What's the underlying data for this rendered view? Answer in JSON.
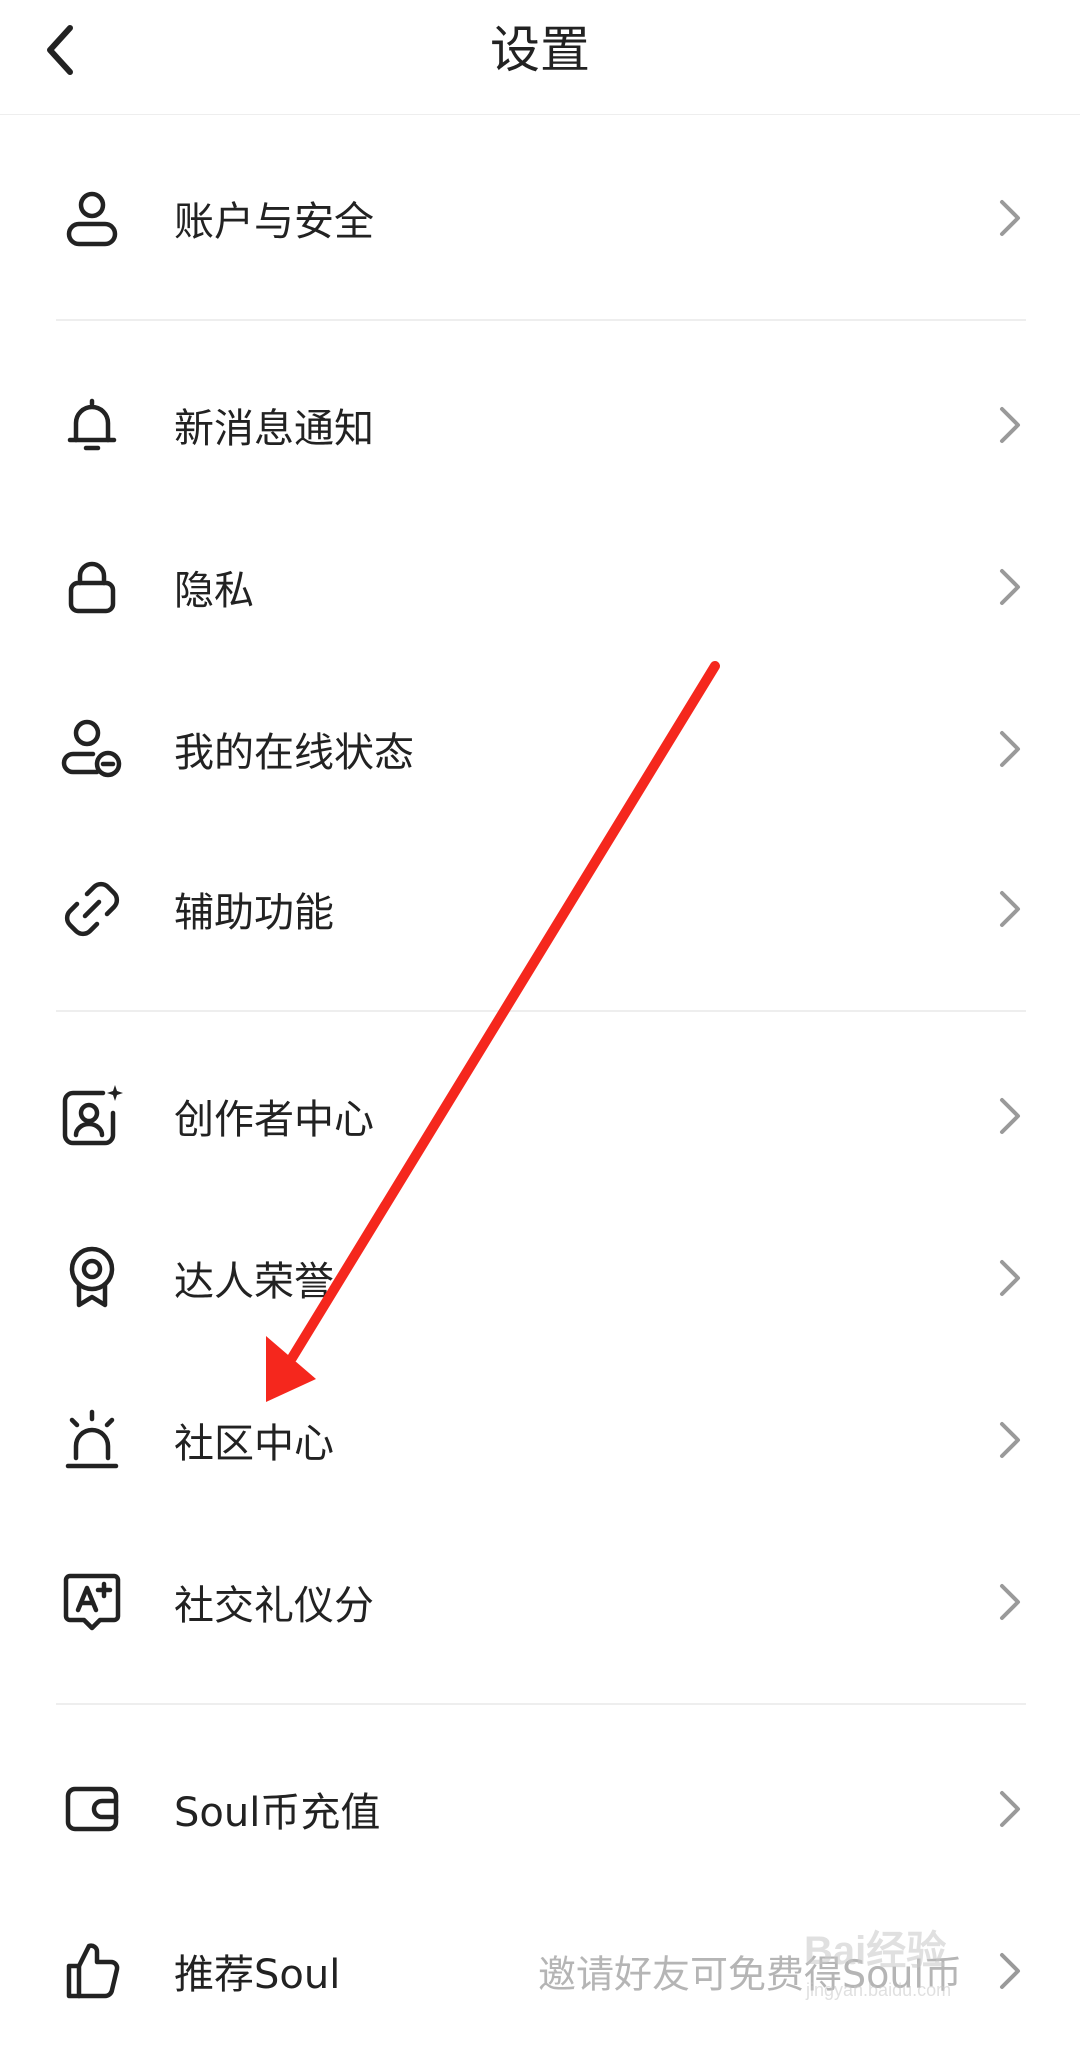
{
  "header": {
    "title": "设置",
    "back_icon": "chevron-left-icon"
  },
  "menu": [
    {
      "id": "account-security",
      "label": "账户与安全",
      "icon": "user-icon"
    },
    {
      "id": "notifications",
      "label": "新消息通知",
      "icon": "bell-icon"
    },
    {
      "id": "privacy",
      "label": "隐私",
      "icon": "lock-icon"
    },
    {
      "id": "online-status",
      "label": "我的在线状态",
      "icon": "user-status-icon"
    },
    {
      "id": "accessibility",
      "label": "辅助功能",
      "icon": "link-icon"
    },
    {
      "id": "creator-center",
      "label": "创作者中心",
      "icon": "creator-portrait-icon"
    },
    {
      "id": "expert-honor",
      "label": "达人荣誉",
      "icon": "badge-icon"
    },
    {
      "id": "community-center",
      "label": "社区中心",
      "icon": "alarm-light-icon"
    },
    {
      "id": "social-etiquette",
      "label": "社交礼仪分",
      "icon": "rating-a-plus-icon"
    },
    {
      "id": "soul-coin",
      "label": "Soul币充值",
      "icon": "wallet-icon"
    },
    {
      "id": "recommend-soul",
      "label": "推荐Soul",
      "icon": "thumbs-up-icon",
      "sublabel": "邀请好友可免费得Soul币"
    }
  ],
  "annotation": {
    "arrow_color": "#f5271d"
  },
  "colors": {
    "text": "#222222",
    "subtext": "#b5b5b5",
    "chevron": "#9a9a9a",
    "divider": "#eeeeee"
  },
  "watermark": {
    "text": "Bai经验",
    "subtext": "jingyan.baidu.com"
  }
}
